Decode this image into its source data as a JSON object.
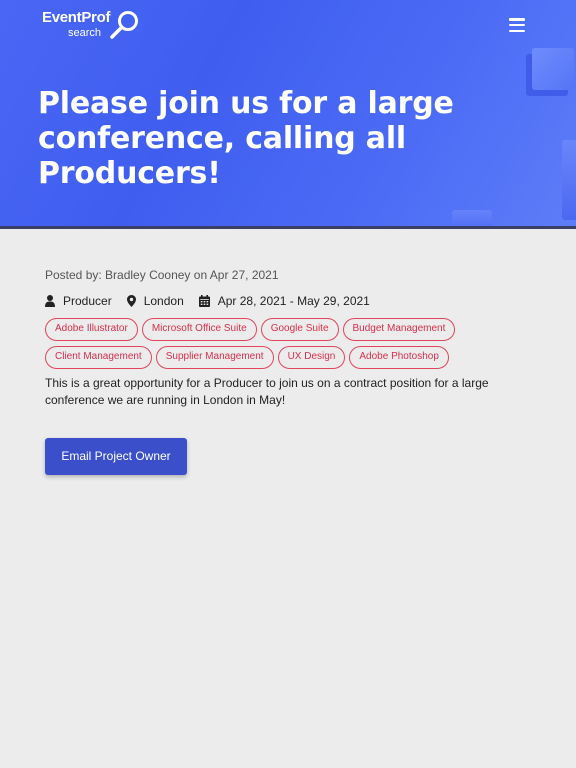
{
  "header": {
    "logo_top": "EventProf",
    "logo_bottom": "search",
    "title": "Please join us for a large conference, calling all Producers!"
  },
  "post": {
    "posted_prefix": "Posted by: ",
    "author": "Bradley Cooney",
    "posted_on": " on Apr 27, 2021",
    "role": "Producer",
    "location": "London",
    "dates": "Apr 28, 2021 - May 29, 2021",
    "tags": [
      "Adobe Illustrator",
      "Microsoft Office Suite",
      "Google Suite",
      "Budget Management",
      "Client Management",
      "Supplier Management",
      "UX Design",
      "Adobe Photoshop"
    ],
    "description": "This is a great opportunity for a Producer to join us on a contract position for a large conference we are running in London in May!",
    "button_label": "Email Project Owner"
  },
  "colors": {
    "hero": "#4a66f5",
    "tag_border": "#e2445c",
    "button": "#3a4fc9",
    "background": "#ececec"
  },
  "icons": [
    "search-icon",
    "menu-icon",
    "user-icon",
    "map-pin-icon",
    "calendar-icon"
  ]
}
